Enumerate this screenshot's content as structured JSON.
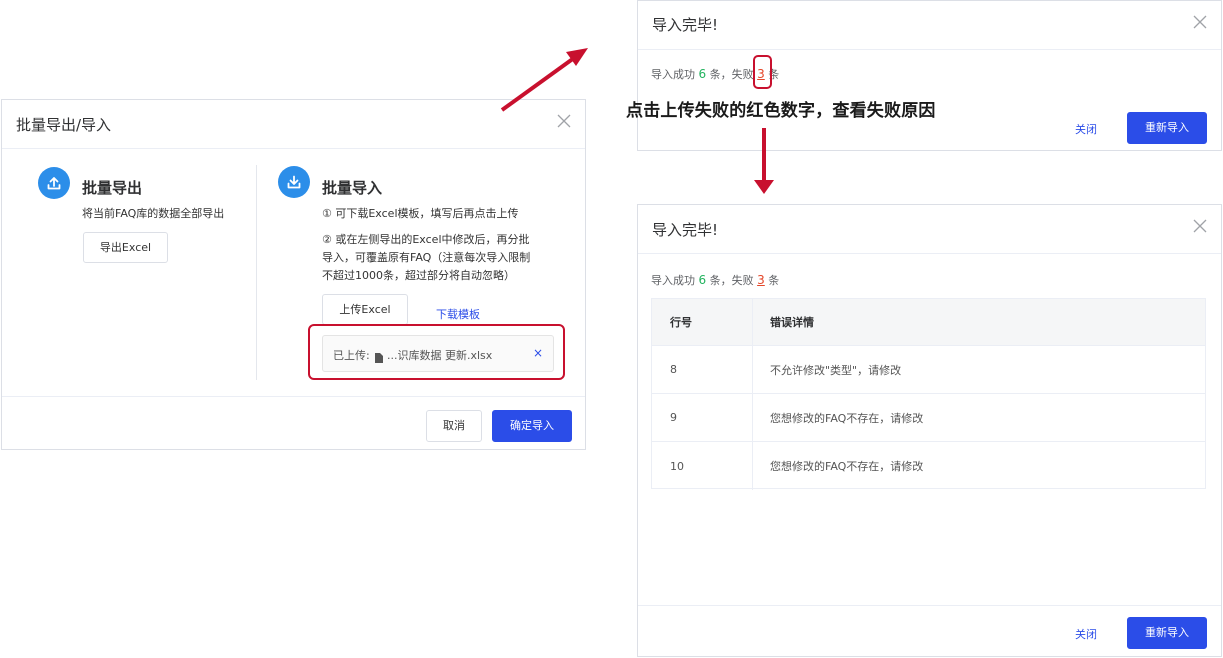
{
  "batch_dialog": {
    "title": "批量导出/导入",
    "export": {
      "title": "批量导出",
      "desc": "将当前FAQ库的数据全部导出",
      "button": "导出Excel"
    },
    "import": {
      "title": "批量导入",
      "step1": "① 可下载Excel模板，填写后再点击上传",
      "step2_line1": "② 或在左侧导出的Excel中修改后，再分批",
      "step2_line2": "导入，可覆盖原有FAQ（注意每次导入限制",
      "step2_line3": "不超过1000条，超过部分将自动忽略）",
      "upload_button": "上传Excel",
      "download_link": "下载模板",
      "uploaded_label": "已上传:",
      "file_name": "...识库数据 更新.xlsx",
      "remove_symbol": "×"
    },
    "cancel_button": "取消",
    "confirm_button": "确定导入"
  },
  "result_dialog_top": {
    "title": "导入完毕!",
    "summary_prefix": "导入成功",
    "success_count": "6",
    "summary_mid": "条，失败",
    "fail_count": "3",
    "summary_suffix": "条",
    "close_link": "关闭",
    "reimport_button": "重新导入"
  },
  "caption": "点击上传失败的红色数字，查看失败原因",
  "result_dialog_bottom": {
    "title": "导入完毕!",
    "summary_prefix": "导入成功",
    "success_count": "6",
    "summary_mid": "条，失败",
    "fail_count": "3",
    "summary_suffix": "条",
    "table": {
      "headers": [
        "行号",
        "错误详情"
      ],
      "rows": [
        {
          "row": "8",
          "detail": "不允许修改\"类型\"，请修改"
        },
        {
          "row": "9",
          "detail": "您想修改的FAQ不存在，请修改"
        },
        {
          "row": "10",
          "detail": "您想修改的FAQ不存在，请修改"
        }
      ]
    },
    "close_link": "关闭",
    "reimport_button": "重新导入"
  },
  "colors": {
    "primary": "#2b4de8",
    "success": "#22b35e",
    "fail": "#e4472a",
    "annotation_red": "#c8102e",
    "icon_blue": "#2c8ee9"
  }
}
